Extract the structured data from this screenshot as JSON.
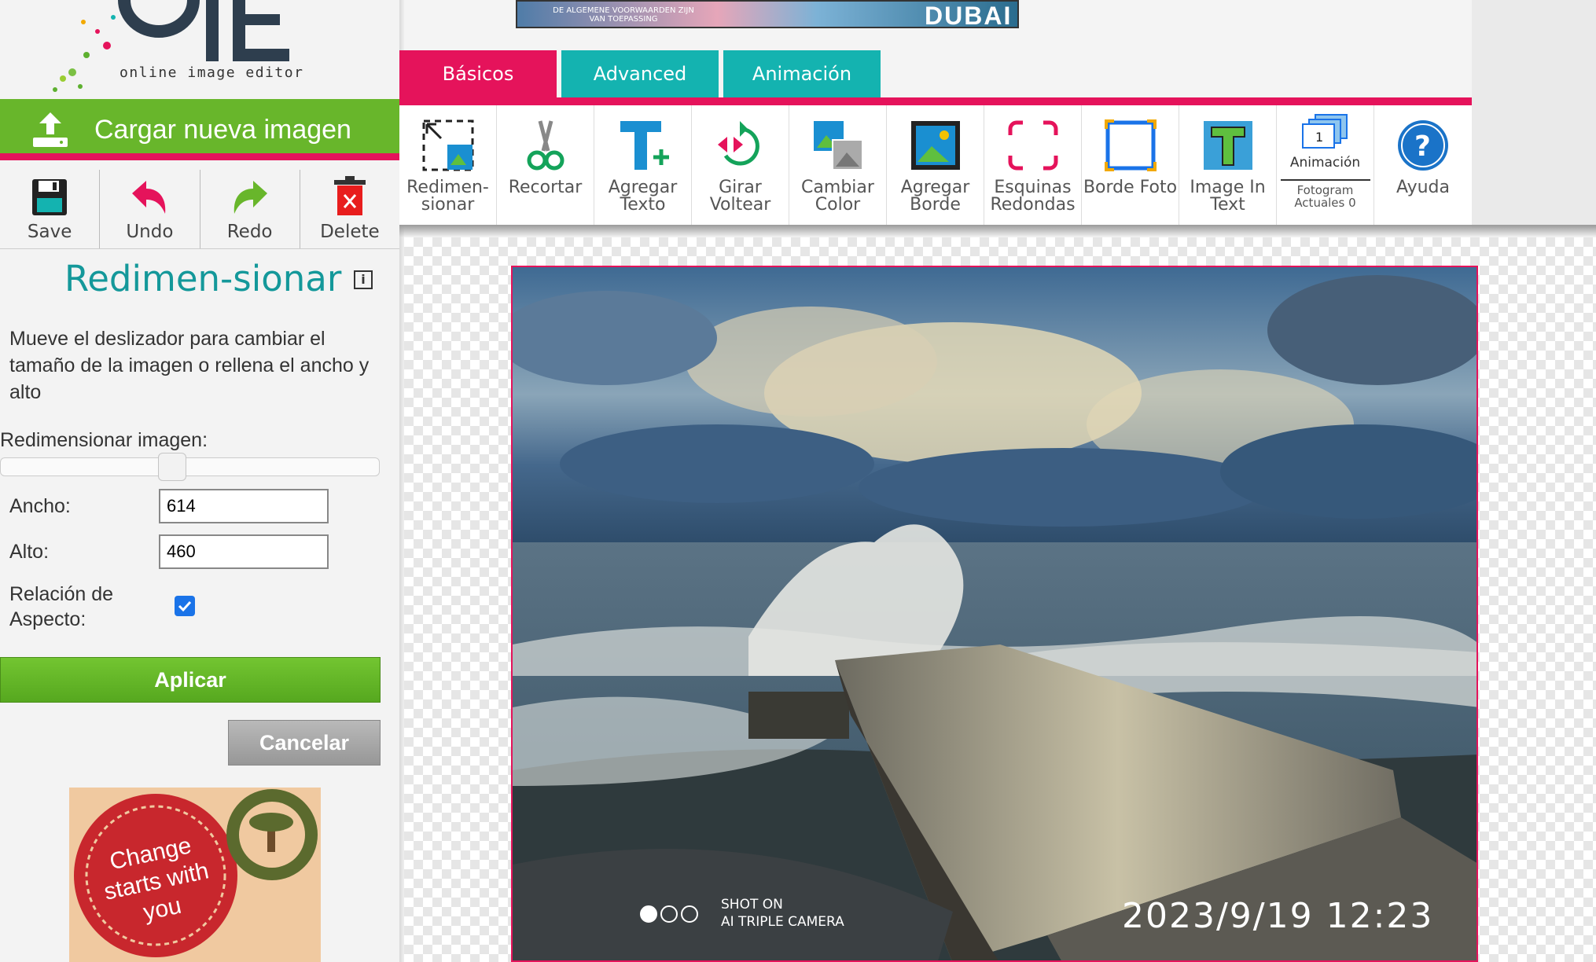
{
  "app": {
    "logo_text": "online image editor"
  },
  "sidebar": {
    "upload_label": "Cargar nueva imagen",
    "file_actions": [
      "Save",
      "Undo",
      "Redo",
      "Delete"
    ],
    "panel_title": "Redimen-sionar",
    "info_icon": "i",
    "description": "Mueve el deslizador para cambiar el tamaño de la imagen o rellena el ancho y alto",
    "resize_label": "Redimensionar imagen:",
    "slider_value_fraction": 0.45,
    "width_label": "Ancho:",
    "width_value": "614",
    "height_label": "Alto:",
    "height_value": "460",
    "aspect_label": "Relación de Aspecto:",
    "aspect_checked": true,
    "apply_label": "Aplicar",
    "cancel_label": "Cancelar",
    "ad_text": "Change starts with you"
  },
  "top_ad": {
    "small_text": "DE ALGEMENE VOORWAARDEN ZIJN VAN TOEPASSING",
    "big_text": "DUBAI"
  },
  "tabs": [
    {
      "label": "Básicos",
      "active": true
    },
    {
      "label": "Advanced",
      "active": false
    },
    {
      "label": "Animación",
      "active": false
    }
  ],
  "toolbar": {
    "tools": [
      {
        "label": "Redimen-sionar",
        "icon": "resize-icon"
      },
      {
        "label": "Recortar",
        "icon": "scissors-icon"
      },
      {
        "label": "Agregar Texto",
        "icon": "text-add-icon"
      },
      {
        "label": "Girar Voltear",
        "icon": "rotate-flip-icon"
      },
      {
        "label": "Cambiar Color",
        "icon": "color-change-icon"
      },
      {
        "label": "Agregar Borde",
        "icon": "border-add-icon"
      },
      {
        "label": "Esquinas Redondas",
        "icon": "rounded-corners-icon"
      },
      {
        "label": "Borde Foto",
        "icon": "photo-border-icon"
      },
      {
        "label": "Image In Text",
        "icon": "image-in-text-icon"
      },
      {
        "label": "Animación",
        "sub": "Fotogram Actuales 0",
        "icon": "animation-frames-icon"
      },
      {
        "label": "Ayuda",
        "icon": "help-icon"
      }
    ]
  },
  "photo": {
    "stamp_date": "2023/9/19  12:23",
    "stamp_shot_line1": "SHOT ON",
    "stamp_shot_line2": "AI TRIPLE CAMERA"
  },
  "colors": {
    "accent_pink": "#e5135b",
    "teal": "#14b3b0",
    "green": "#68b62b"
  }
}
